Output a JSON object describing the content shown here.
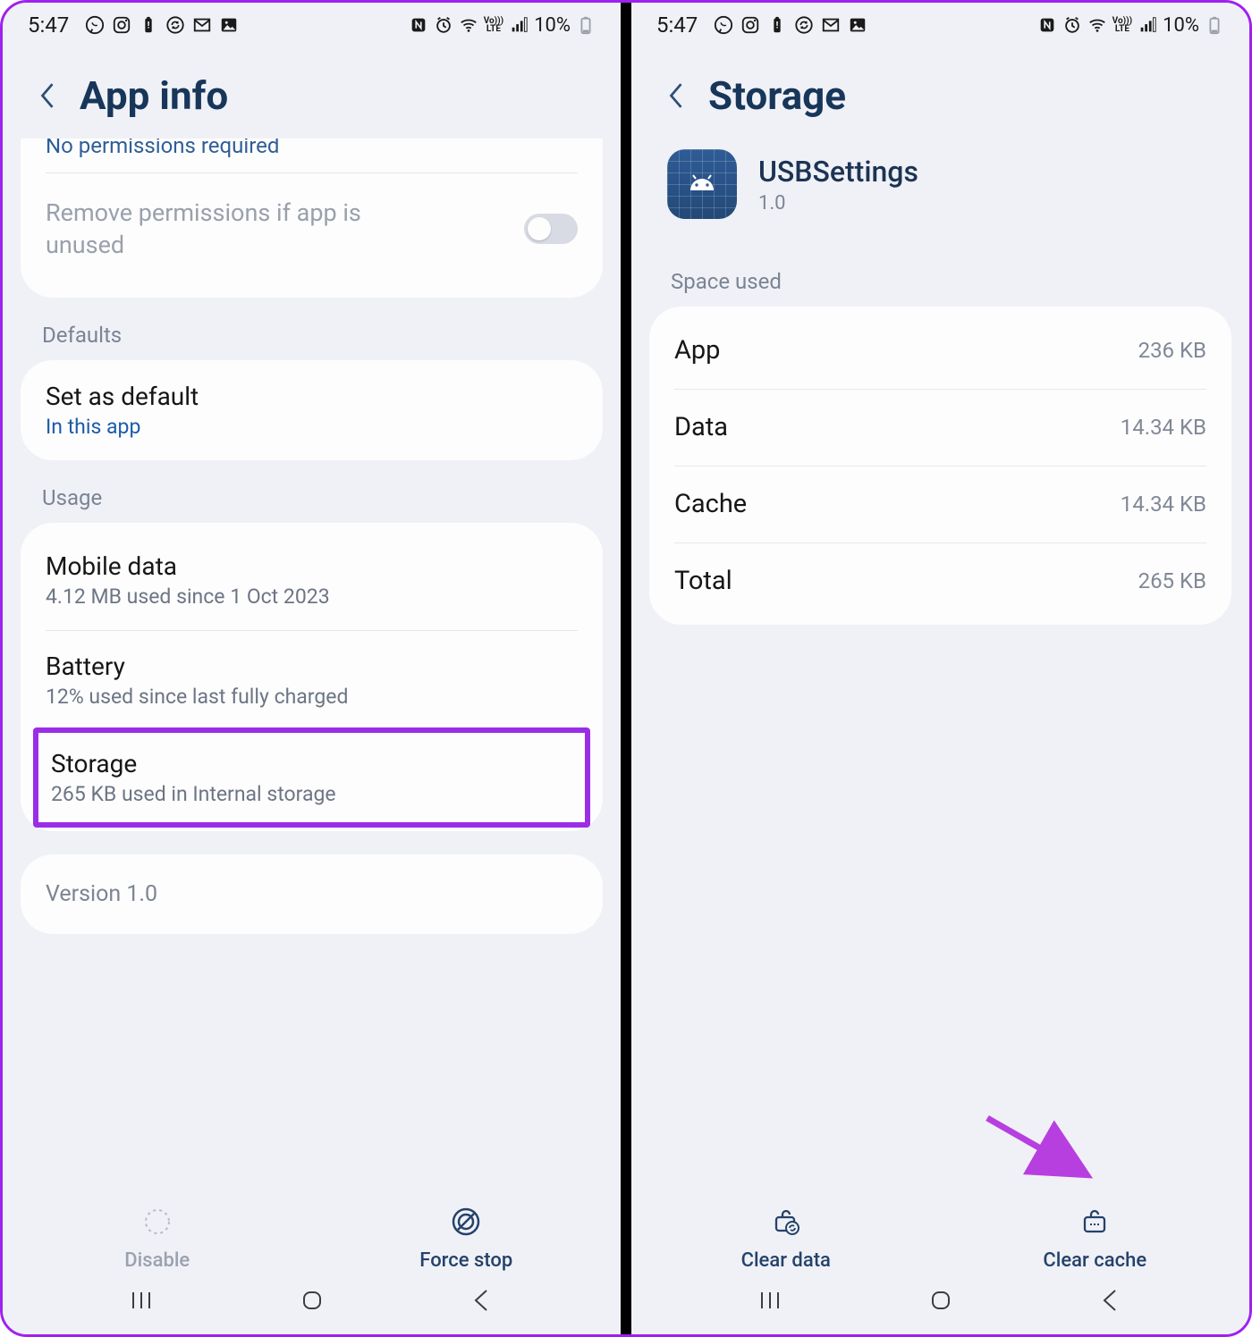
{
  "status": {
    "time": "5:47",
    "battery_pct": "10%",
    "volte_top": "Vo)))",
    "volte_bot": "LTE"
  },
  "left": {
    "header": "App info",
    "clipped_text": "No permissions required",
    "remove_perm": "Remove permissions if app is unused",
    "sections": {
      "defaults": "Defaults",
      "usage": "Usage"
    },
    "set_default": {
      "title": "Set as default",
      "sub": "In this app"
    },
    "mobile_data": {
      "title": "Mobile data",
      "sub": "4.12 MB used since 1 Oct 2023"
    },
    "battery": {
      "title": "Battery",
      "sub": "12% used since last fully charged"
    },
    "storage": {
      "title": "Storage",
      "sub": "265 KB used in Internal storage"
    },
    "version": "Version 1.0",
    "actions": {
      "disable": "Disable",
      "force_stop": "Force stop"
    }
  },
  "right": {
    "header": "Storage",
    "app": {
      "name": "USBSettings",
      "version": "1.0"
    },
    "section": "Space used",
    "rows": {
      "app": {
        "label": "App",
        "value": "236 KB"
      },
      "data": {
        "label": "Data",
        "value": "14.34 KB"
      },
      "cache": {
        "label": "Cache",
        "value": "14.34 KB"
      },
      "total": {
        "label": "Total",
        "value": "265 KB"
      }
    },
    "actions": {
      "clear_data": "Clear data",
      "clear_cache": "Clear cache"
    }
  }
}
